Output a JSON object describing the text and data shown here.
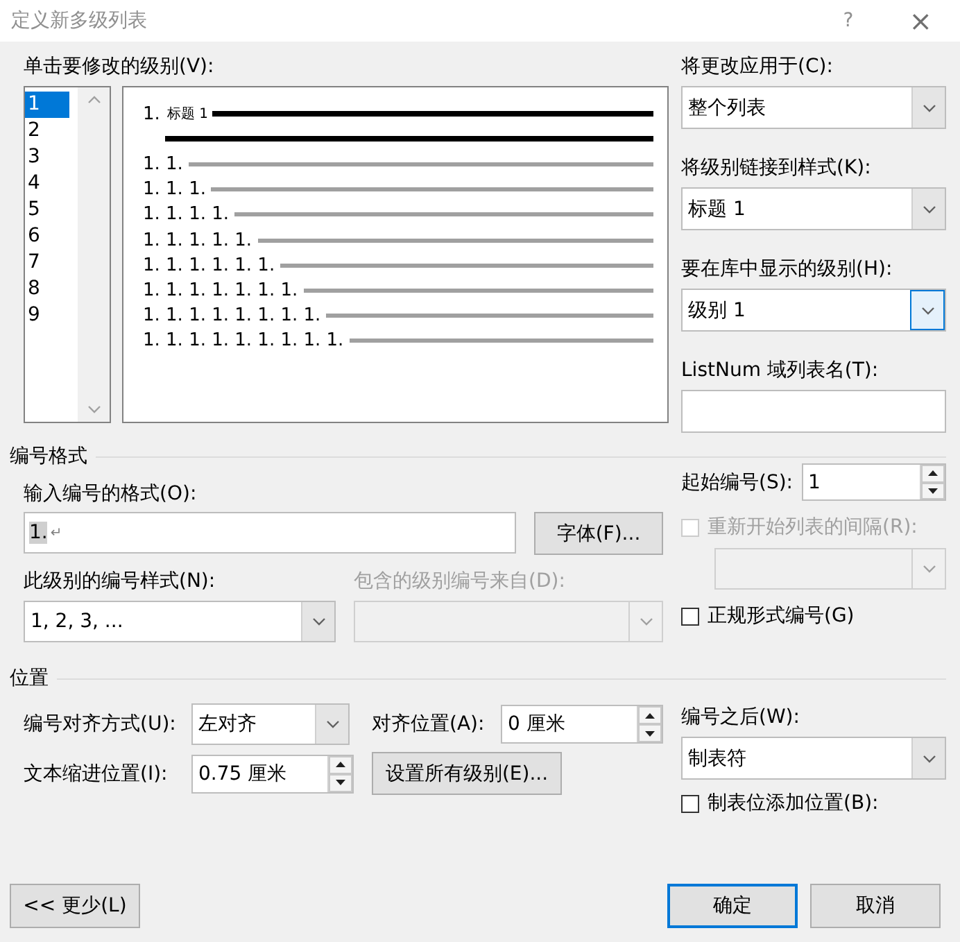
{
  "window": {
    "title": "定义新多级列表",
    "help": "?",
    "close": "×"
  },
  "level_list": {
    "label": "单击要修改的级别(V):",
    "items": [
      {
        "label": "1",
        "selected": true
      },
      {
        "label": "2",
        "selected": false
      },
      {
        "label": "3",
        "selected": false
      },
      {
        "label": "4",
        "selected": false
      },
      {
        "label": "5",
        "selected": false
      },
      {
        "label": "6",
        "selected": false
      },
      {
        "label": "7",
        "selected": false
      },
      {
        "label": "8",
        "selected": false
      },
      {
        "label": "9",
        "selected": false
      }
    ]
  },
  "preview": {
    "lines": [
      {
        "kind": "heading",
        "number": "1.",
        "text": "标题 1"
      },
      {
        "kind": "continuation"
      },
      {
        "kind": "level",
        "number": "1. 1."
      },
      {
        "kind": "level",
        "number": "1. 1. 1."
      },
      {
        "kind": "level",
        "number": "1. 1. 1. 1."
      },
      {
        "kind": "level",
        "number": "1. 1. 1. 1. 1."
      },
      {
        "kind": "level",
        "number": "1. 1. 1. 1. 1. 1."
      },
      {
        "kind": "level",
        "number": "1. 1. 1. 1. 1. 1. 1."
      },
      {
        "kind": "level",
        "number": "1. 1. 1. 1. 1. 1. 1. 1."
      },
      {
        "kind": "level",
        "number": "1. 1. 1. 1. 1. 1. 1. 1. 1."
      }
    ]
  },
  "apply_to": {
    "label": "将更改应用于(C):",
    "value": "整个列表"
  },
  "link_style": {
    "label": "将级别链接到样式(K):",
    "value": "标题 1"
  },
  "gallery_level": {
    "label": "要在库中显示的级别(H):",
    "value": "级别 1",
    "focused": true
  },
  "listnum": {
    "label": "ListNum 域列表名(T):"
  },
  "number_format": {
    "title": "编号格式",
    "format_label": "输入编号的格式(O):",
    "format_value": "1.",
    "format_selected": true,
    "paragraph_mark": "↵",
    "font_button": "字体(F)...",
    "style_label": "此级别的编号样式(N):",
    "style_value": "1, 2, 3, ...",
    "include_label": "包含的级别编号来自(D):",
    "include_disabled": true,
    "start_label": "起始编号(S):",
    "start_value": "1",
    "restart": {
      "label": "重新开始列表的间隔(R):",
      "checked": false,
      "disabled": true
    },
    "restart_list_disabled": true,
    "legal": {
      "label": "正规形式编号(G)",
      "checked": false,
      "disabled": false
    }
  },
  "position": {
    "title": "位置",
    "align_label": "编号对齐方式(U):",
    "align_value": "左对齐",
    "at_label": "对齐位置(A):",
    "at_value": "0 厘米",
    "indent_label": "文本缩进位置(I):",
    "indent_value": "0.75 厘米",
    "set_all_button": "设置所有级别(E)...",
    "follow_label": "编号之后(W):",
    "follow_value": "制表符",
    "tab_stop": {
      "label": "制表位添加位置(B):",
      "checked": false,
      "disabled": false
    }
  },
  "buttons": [
    {
      "label": "<< 更少(L)",
      "kind": "toggle"
    },
    {
      "label": "确定",
      "kind": "default"
    },
    {
      "label": "取消",
      "kind": "normal"
    }
  ]
}
